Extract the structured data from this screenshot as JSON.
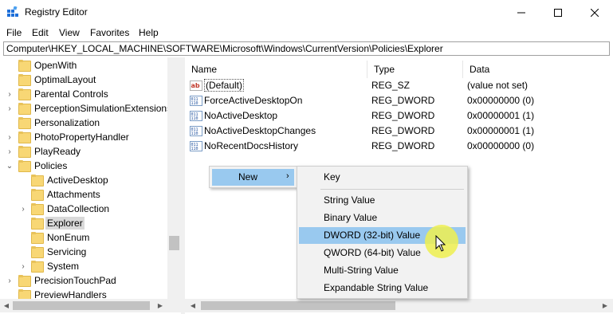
{
  "window": {
    "title": "Registry Editor",
    "buttons": {
      "minimize": "—",
      "maximize": "☐",
      "close": "✕"
    }
  },
  "menu": [
    "File",
    "Edit",
    "View",
    "Favorites",
    "Help"
  ],
  "address": "Computer\\HKEY_LOCAL_MACHINE\\SOFTWARE\\Microsoft\\Windows\\CurrentVersion\\Policies\\Explorer",
  "tree": {
    "items": [
      {
        "label": "OpenWith",
        "expander": ""
      },
      {
        "label": "OptimalLayout",
        "expander": ""
      },
      {
        "label": "Parental Controls",
        "expander": "›"
      },
      {
        "label": "PerceptionSimulationExtensions",
        "expander": "›"
      },
      {
        "label": "Personalization",
        "expander": ""
      },
      {
        "label": "PhotoPropertyHandler",
        "expander": "›"
      },
      {
        "label": "PlayReady",
        "expander": "›"
      },
      {
        "label": "Policies",
        "expander": "⌄"
      },
      {
        "label": "ActiveDesktop",
        "expander": ""
      },
      {
        "label": "Attachments",
        "expander": ""
      },
      {
        "label": "DataCollection",
        "expander": "›"
      },
      {
        "label": "Explorer",
        "expander": ""
      },
      {
        "label": "NonEnum",
        "expander": ""
      },
      {
        "label": "Servicing",
        "expander": ""
      },
      {
        "label": "System",
        "expander": "›"
      },
      {
        "label": "PrecisionTouchPad",
        "expander": "›"
      },
      {
        "label": "PreviewHandlers",
        "expander": ""
      }
    ]
  },
  "list": {
    "columns": {
      "name": "Name",
      "type": "Type",
      "data": "Data"
    },
    "rows": [
      {
        "name": "(Default)",
        "type": "REG_SZ",
        "data": "(value not set)",
        "icon": "string-value-icon"
      },
      {
        "name": "ForceActiveDesktopOn",
        "type": "REG_DWORD",
        "data": "0x00000000 (0)",
        "icon": "binary-value-icon"
      },
      {
        "name": "NoActiveDesktop",
        "type": "REG_DWORD",
        "data": "0x00000001 (1)",
        "icon": "binary-value-icon"
      },
      {
        "name": "NoActiveDesktopChanges",
        "type": "REG_DWORD",
        "data": "0x00000001 (1)",
        "icon": "binary-value-icon"
      },
      {
        "name": "NoRecentDocsHistory",
        "type": "REG_DWORD",
        "data": "0x00000000 (0)",
        "icon": "binary-value-icon"
      }
    ]
  },
  "context_menu": {
    "new_label": "New",
    "new_arrow": "›",
    "submenu": {
      "key": "Key",
      "items": [
        "String Value",
        "Binary Value",
        "DWORD (32-bit) Value",
        "QWORD (64-bit) Value",
        "Multi-String Value",
        "Expandable String Value"
      ],
      "highlighted": "DWORD (32-bit) Value"
    }
  },
  "colors": {
    "highlight": "#99c9ef",
    "folder": "#f8d775",
    "cursor_halo": "#eef050"
  }
}
